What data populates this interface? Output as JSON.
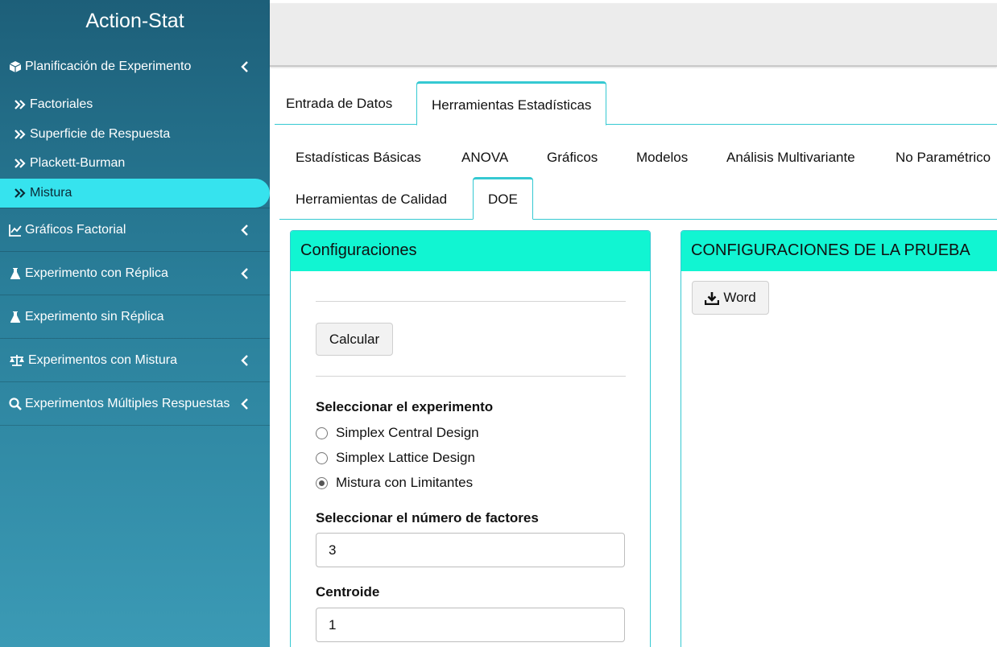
{
  "app": {
    "title": "Action-Stat"
  },
  "sidebar": {
    "items": [
      {
        "label": "Planificación de Experimento",
        "icon": "cube-icon",
        "expandable": true,
        "children": [
          {
            "label": "Factoriales"
          },
          {
            "label": "Superficie de Respuesta"
          },
          {
            "label": "Plackett-Burman"
          },
          {
            "label": "Mistura",
            "active": true
          }
        ]
      },
      {
        "label": "Gráficos Factorial",
        "icon": "line-chart-icon",
        "expandable": true
      },
      {
        "label": "Experimento con Réplica",
        "icon": "flask-icon",
        "expandable": true
      },
      {
        "label": "Experimento sin Réplica",
        "icon": "flask-icon",
        "expandable": false
      },
      {
        "label": "Experimentos con Mistura",
        "icon": "balance-scale-icon",
        "expandable": true
      },
      {
        "label": "Experimentos Múltiples Respuestas",
        "icon": "search-icon",
        "expandable": true
      }
    ]
  },
  "tabs_main": [
    {
      "label": "Entrada de Datos"
    },
    {
      "label": "Herramientas Estadísticas",
      "active": true
    }
  ],
  "tabs_sub": [
    {
      "label": "Estadísticas Básicas"
    },
    {
      "label": "ANOVA"
    },
    {
      "label": "Gráficos"
    },
    {
      "label": "Modelos"
    },
    {
      "label": "Análisis Multivariante"
    },
    {
      "label": "No Paramétrico"
    },
    {
      "label": "Herramientas de Calidad"
    },
    {
      "label": "DOE",
      "active": true
    }
  ],
  "config_panel": {
    "title": "Configuraciones",
    "calc_button": "Calcular",
    "experiment_label": "Seleccionar el experimento",
    "experiment_options": [
      {
        "label": "Simplex Central Design",
        "checked": false
      },
      {
        "label": "Simplex Lattice Design",
        "checked": false
      },
      {
        "label": "Mistura con Limitantes",
        "checked": true
      }
    ],
    "factors_label": "Seleccionar el número de factores",
    "factors_value": "3",
    "centroid_label": "Centroide",
    "centroid_value": "1"
  },
  "test_panel": {
    "title": "CONFIGURACIONES DE LA PRUEBA",
    "word_button": "Word"
  },
  "colors": {
    "accent": "#35c9d2",
    "panel_header": "#11f5d2",
    "active_item": "#36e3ee",
    "sidebar_top": "#1d5f79",
    "sidebar_bottom": "#3b9ab5"
  }
}
